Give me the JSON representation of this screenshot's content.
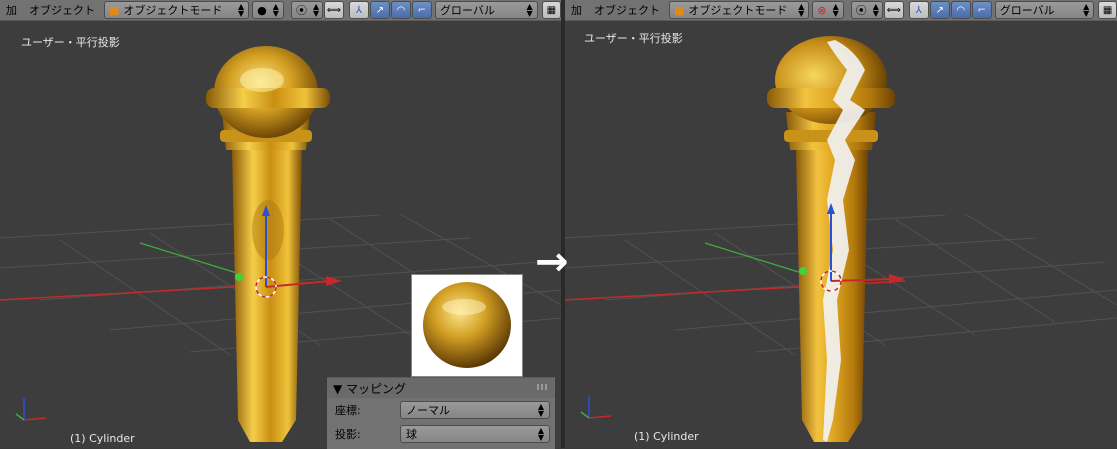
{
  "left_viewport": {
    "header": {
      "add_menu": "加",
      "object_menu": "オブジェクト",
      "mode": "オブジェクトモード",
      "transform_orientation": "グローバル"
    },
    "view_label": "ユーザー・平行投影",
    "object_label": "(1) Cylinder"
  },
  "right_viewport": {
    "header": {
      "add_menu": "加",
      "object_menu": "オブジェクト",
      "mode": "オブジェクトモード",
      "transform_orientation": "グローバル"
    },
    "view_label": "ユーザー・平行投影",
    "object_label": "(1) Cylinder"
  },
  "transition_arrow": "→",
  "mapping_panel": {
    "title": "▼ マッピング",
    "coordinates_label": "座標:",
    "coordinates_value": "ノーマル",
    "projection_label": "投影:",
    "projection_value": "球"
  },
  "colors": {
    "viewport_bg": "#3d3d3d",
    "header_bg": "#727272",
    "gold": "#d9a21e",
    "x_axis": "#c42a2a",
    "y_axis": "#3fae3f",
    "z_axis": "#2b4fd6"
  }
}
